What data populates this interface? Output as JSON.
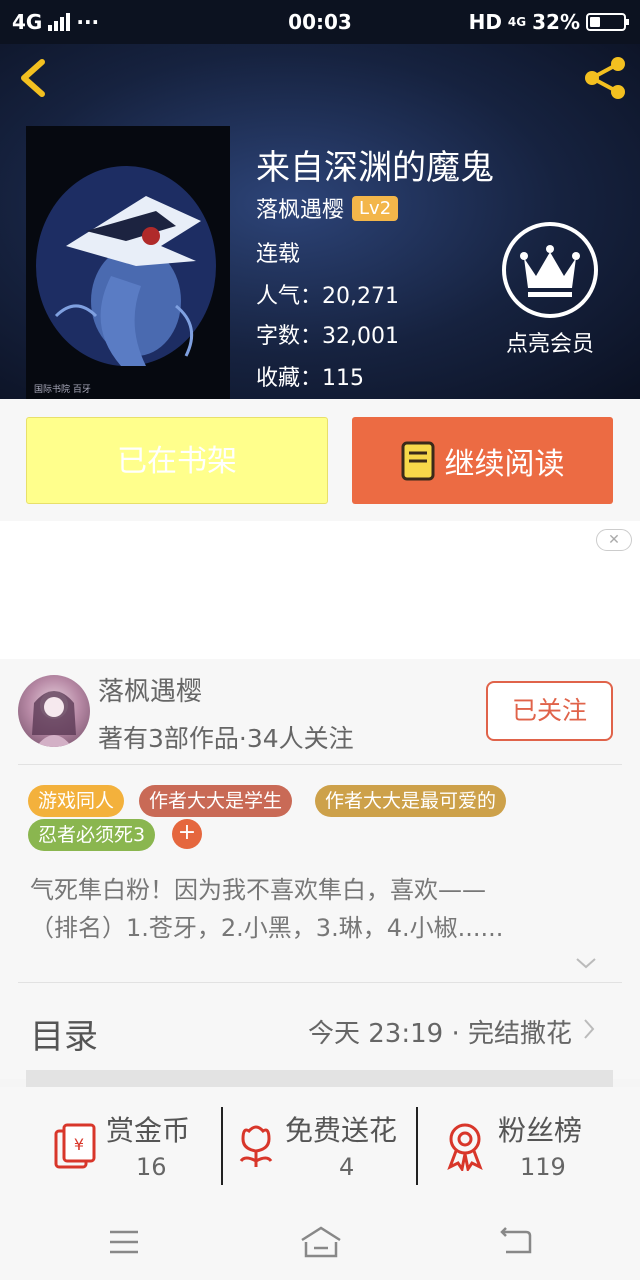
{
  "status_bar": {
    "network": "4G",
    "dots": "···",
    "time": "00:03",
    "hd": "HD",
    "net2": "4G",
    "battery": "32%",
    "battery_level": 0.32
  },
  "book": {
    "title": "来自深渊的魔鬼",
    "author": "落枫遇樱",
    "level": "Lv2",
    "status": "连载",
    "popularity": "人气：20,271",
    "word_count": "字数：32,001",
    "favorites": "收藏：115",
    "cover_credit": "国际书院 百牙"
  },
  "vip": {
    "label": "点亮会员"
  },
  "actions": {
    "shelf_label": "已在书架",
    "read_label": "继续阅读"
  },
  "ad": {
    "close_symbol": "✕"
  },
  "author_card": {
    "name": "落枫遇樱",
    "subtitle": "著有3部作品·34人关注",
    "follow_label": "已关注",
    "tags": [
      {
        "label": "游戏同人",
        "color": "#f3b13c"
      },
      {
        "label": "作者大大是学生",
        "color": "#c96a56"
      },
      {
        "label": "作者大大是最可爱的",
        "color": "#cda14a"
      },
      {
        "label": "忍者必须死3",
        "color": "#8ab64f"
      }
    ],
    "tag_add": "+",
    "intro_line1": "气死隼白粉！因为我不喜欢隼白，喜欢——",
    "intro_line2": "（排名）1.苍牙，2.小黑，3.琳，4.小椒......"
  },
  "toc": {
    "label": "目录",
    "latest": "今天 23:19 · 完结撒花"
  },
  "stats": [
    {
      "label": "赏金币",
      "value": "16",
      "icon": "red-envelope-icon"
    },
    {
      "label": "免费送花",
      "value": "4",
      "icon": "flower-icon"
    },
    {
      "label": "粉丝榜",
      "value": "119",
      "icon": "medal-icon"
    }
  ],
  "colors": {
    "accent_orange": "#ec6b43",
    "shelf_yellow": "#ffff8c",
    "icon_red": "#d8362a",
    "header_gold": "#f3c020"
  }
}
